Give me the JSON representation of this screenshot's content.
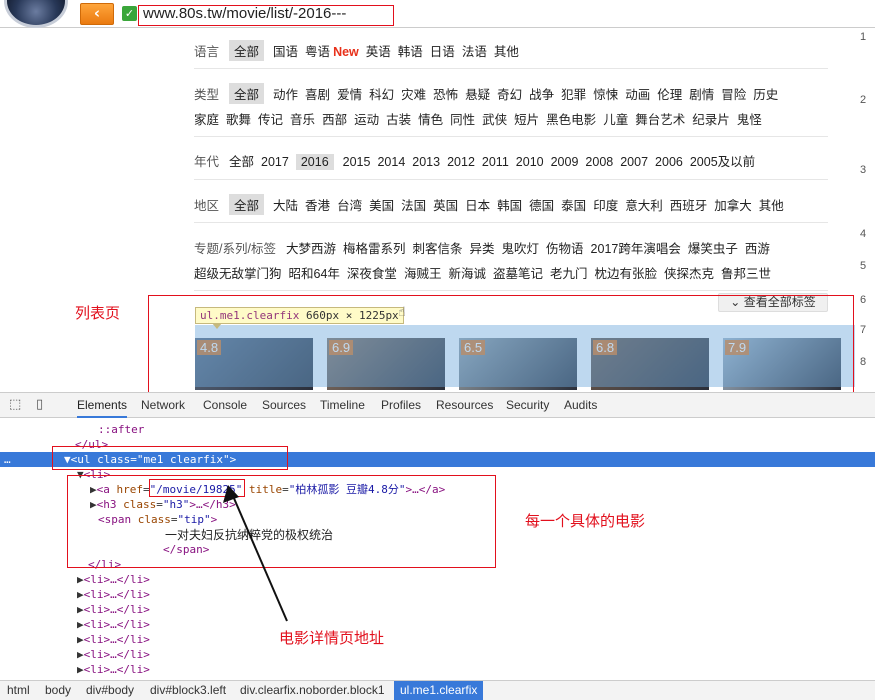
{
  "browser": {
    "url": "www.80s.tw/movie/list/-2016---",
    "back_icon": "back-arrow-icon",
    "secure_icon": "check-icon"
  },
  "filters": {
    "language": {
      "label": "语言",
      "selected": "全部",
      "items": [
        "国语",
        "粤语"
      ],
      "new_badge": "New",
      "items_after": [
        "英语",
        "韩语",
        "日语",
        "法语",
        "其他"
      ]
    },
    "genre": {
      "label": "类型",
      "selected": "全部",
      "items": [
        "动作",
        "喜剧",
        "爱情",
        "科幻",
        "灾难",
        "恐怖",
        "悬疑",
        "奇幻",
        "战争",
        "犯罪",
        "惊悚",
        "动画",
        "伦理",
        "剧情",
        "冒险",
        "历史"
      ],
      "items2": [
        "家庭",
        "歌舞",
        "传记",
        "音乐",
        "西部",
        "运动",
        "古装",
        "情色",
        "同性",
        "武侠",
        "短片",
        "黑色电影",
        "儿童",
        "舞台艺术",
        "纪录片",
        "鬼怪"
      ]
    },
    "year": {
      "label": "年代",
      "items": [
        "全部",
        "2017"
      ],
      "selected": "2016",
      "items_after": [
        "2015",
        "2014",
        "2013",
        "2012",
        "2011",
        "2010",
        "2009",
        "2008",
        "2007",
        "2006",
        "2005及以前"
      ]
    },
    "region": {
      "label": "地区",
      "selected": "全部",
      "items": [
        "大陆",
        "香港",
        "台湾",
        "美国",
        "法国",
        "英国",
        "日本",
        "韩国",
        "德国",
        "泰国",
        "印度",
        "意大利",
        "西班牙",
        "加拿大",
        "其他"
      ]
    },
    "topics": {
      "label": "专题/系列/标签",
      "items": [
        "大梦西游",
        "梅格雷系列",
        "刺客信条",
        "异类",
        "鬼吹灯",
        "伤物语",
        "2017跨年演唱会",
        "爆笑虫子",
        "西游"
      ],
      "items2": [
        "超级无敌掌门狗",
        "昭和64年",
        "深夜食堂",
        "海贼王",
        "新海诚",
        "盗墓笔记",
        "老九门",
        "枕边有张脸",
        "侠探杰克",
        "鲁邦三世"
      ]
    }
  },
  "row_numbers": [
    "1",
    "2",
    "3",
    "4",
    "5",
    "6",
    "7",
    "8"
  ],
  "see_all": "查看全部标签",
  "tooltip": {
    "selector": "ul.me1.clearfix",
    "size": "660px × 1225px"
  },
  "thumbs": [
    {
      "score": "4.8",
      "color": "#5b6a80"
    },
    {
      "score": "6.9",
      "color": "#8a7462"
    },
    {
      "score": "6.5",
      "color": "#9aa3a8"
    },
    {
      "score": "6.8",
      "color": "#6e5a4c"
    },
    {
      "score": "7.9",
      "color": "#a7b8c7"
    }
  ],
  "annotations": {
    "list_page": "列表页",
    "each_movie": "每一个具体的电影",
    "detail_url": "电影详情页地址"
  },
  "devtools": {
    "tabs": [
      "Elements",
      "Network",
      "Console",
      "Sources",
      "Timeline",
      "Profiles",
      "Resources",
      "Security",
      "Audits"
    ],
    "dom": {
      "after": "::after",
      "ul_close": "</ul>",
      "ul_open": {
        "tag": "ul",
        "attr": "class",
        "value": "me1 clearfix"
      },
      "li_open": "<li>",
      "a_line": {
        "href": "/movie/19825",
        "title": "柏林孤影  豆瓣4.8分"
      },
      "h3_line": {
        "attr": "class",
        "value": "h3"
      },
      "span_line": {
        "attr": "class",
        "value": "tip"
      },
      "tip_text": "一对夫妇反抗纳粹党的极权统治",
      "span_close": "</span>",
      "li_close": "</li>",
      "collapsed_li": "<li>…</li>"
    },
    "breadcrumb": [
      "html",
      "body",
      "div#body",
      "div#block3.left",
      "div.clearfix.noborder.block1",
      "ul.me1.clearfix"
    ]
  }
}
